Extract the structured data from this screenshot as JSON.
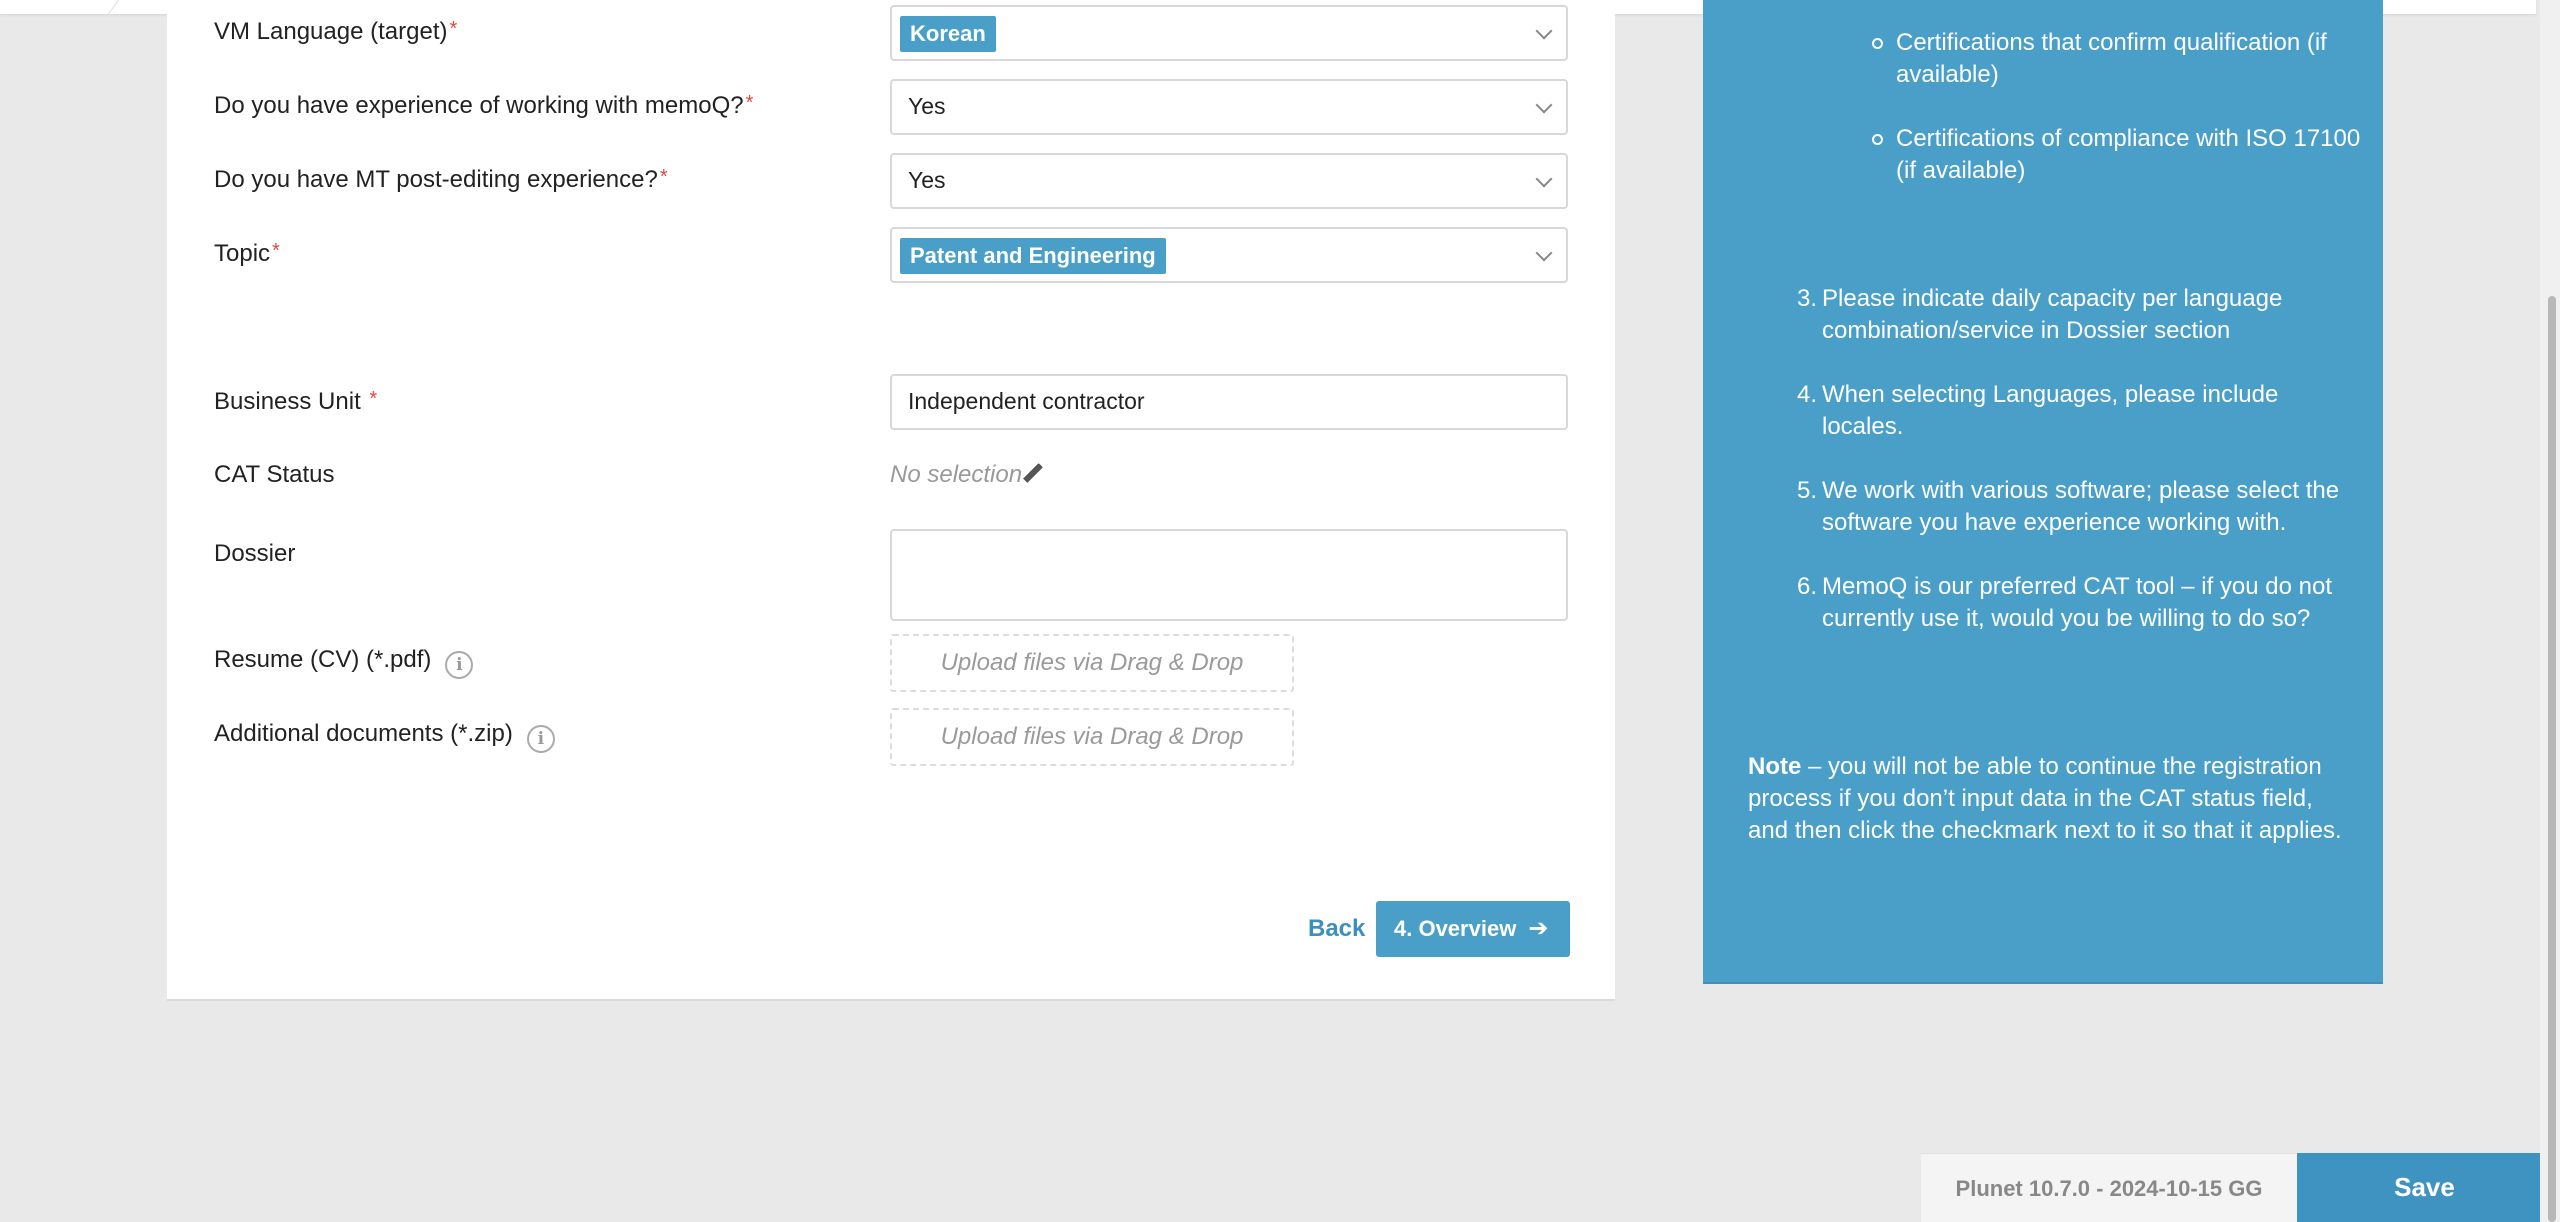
{
  "form": {
    "vm_language_target": {
      "label": "VM Language (target)",
      "tag": "Korean"
    },
    "memoq_experience": {
      "label": "Do you have experience of working with memoQ?",
      "value": "Yes"
    },
    "mt_postediting": {
      "label": "Do you have MT post-editing experience?",
      "value": "Yes"
    },
    "topic": {
      "label": "Topic",
      "tag": "Patent and Engineering"
    },
    "business_unit": {
      "label": "Business Unit",
      "value": "Independent contractor"
    },
    "cat_status": {
      "label": "CAT Status",
      "value": "No selection"
    },
    "dossier": {
      "label": "Dossier",
      "value": ""
    },
    "resume": {
      "label": "Resume (CV) (*.pdf)",
      "dropzone": "Upload files via Drag & Drop"
    },
    "additional_docs": {
      "label": "Additional documents (*.zip)",
      "dropzone": "Upload files via Drag & Drop"
    },
    "required_mark": "*",
    "info_glyph": "i",
    "back_label": "Back",
    "next_label": "4. Overview",
    "next_arrow": "➔"
  },
  "info_panel": {
    "sub_items": [
      "Certifications that confirm qualification (if available)",
      "Certifications of compliance with ISO 17100 (if available)"
    ],
    "items": [
      {
        "num": "3.",
        "text": "Please indicate daily capacity per language combination/service in Dossier section"
      },
      {
        "num": "4.",
        "text": "When selecting Languages, please include locales."
      },
      {
        "num": "5.",
        "text": "We work with various software; please select the software you have experience working with."
      },
      {
        "num": "6.",
        "text": "MemoQ is our preferred CAT tool – if you do not currently use it, would you be willing to do so?"
      }
    ],
    "note_bold": "Note",
    "note_text": " – you will not be able to continue the registration process if you don’t input data in the CAT status field, and then click the checkmark next to it so that it applies."
  },
  "footer": {
    "version": "Plunet 10.7.0 - 2024-10-15 GG",
    "save_label": "Save"
  },
  "colors": {
    "accent": "#4a9fc8",
    "required": "#e0483e",
    "background": "#e9e9e9"
  }
}
